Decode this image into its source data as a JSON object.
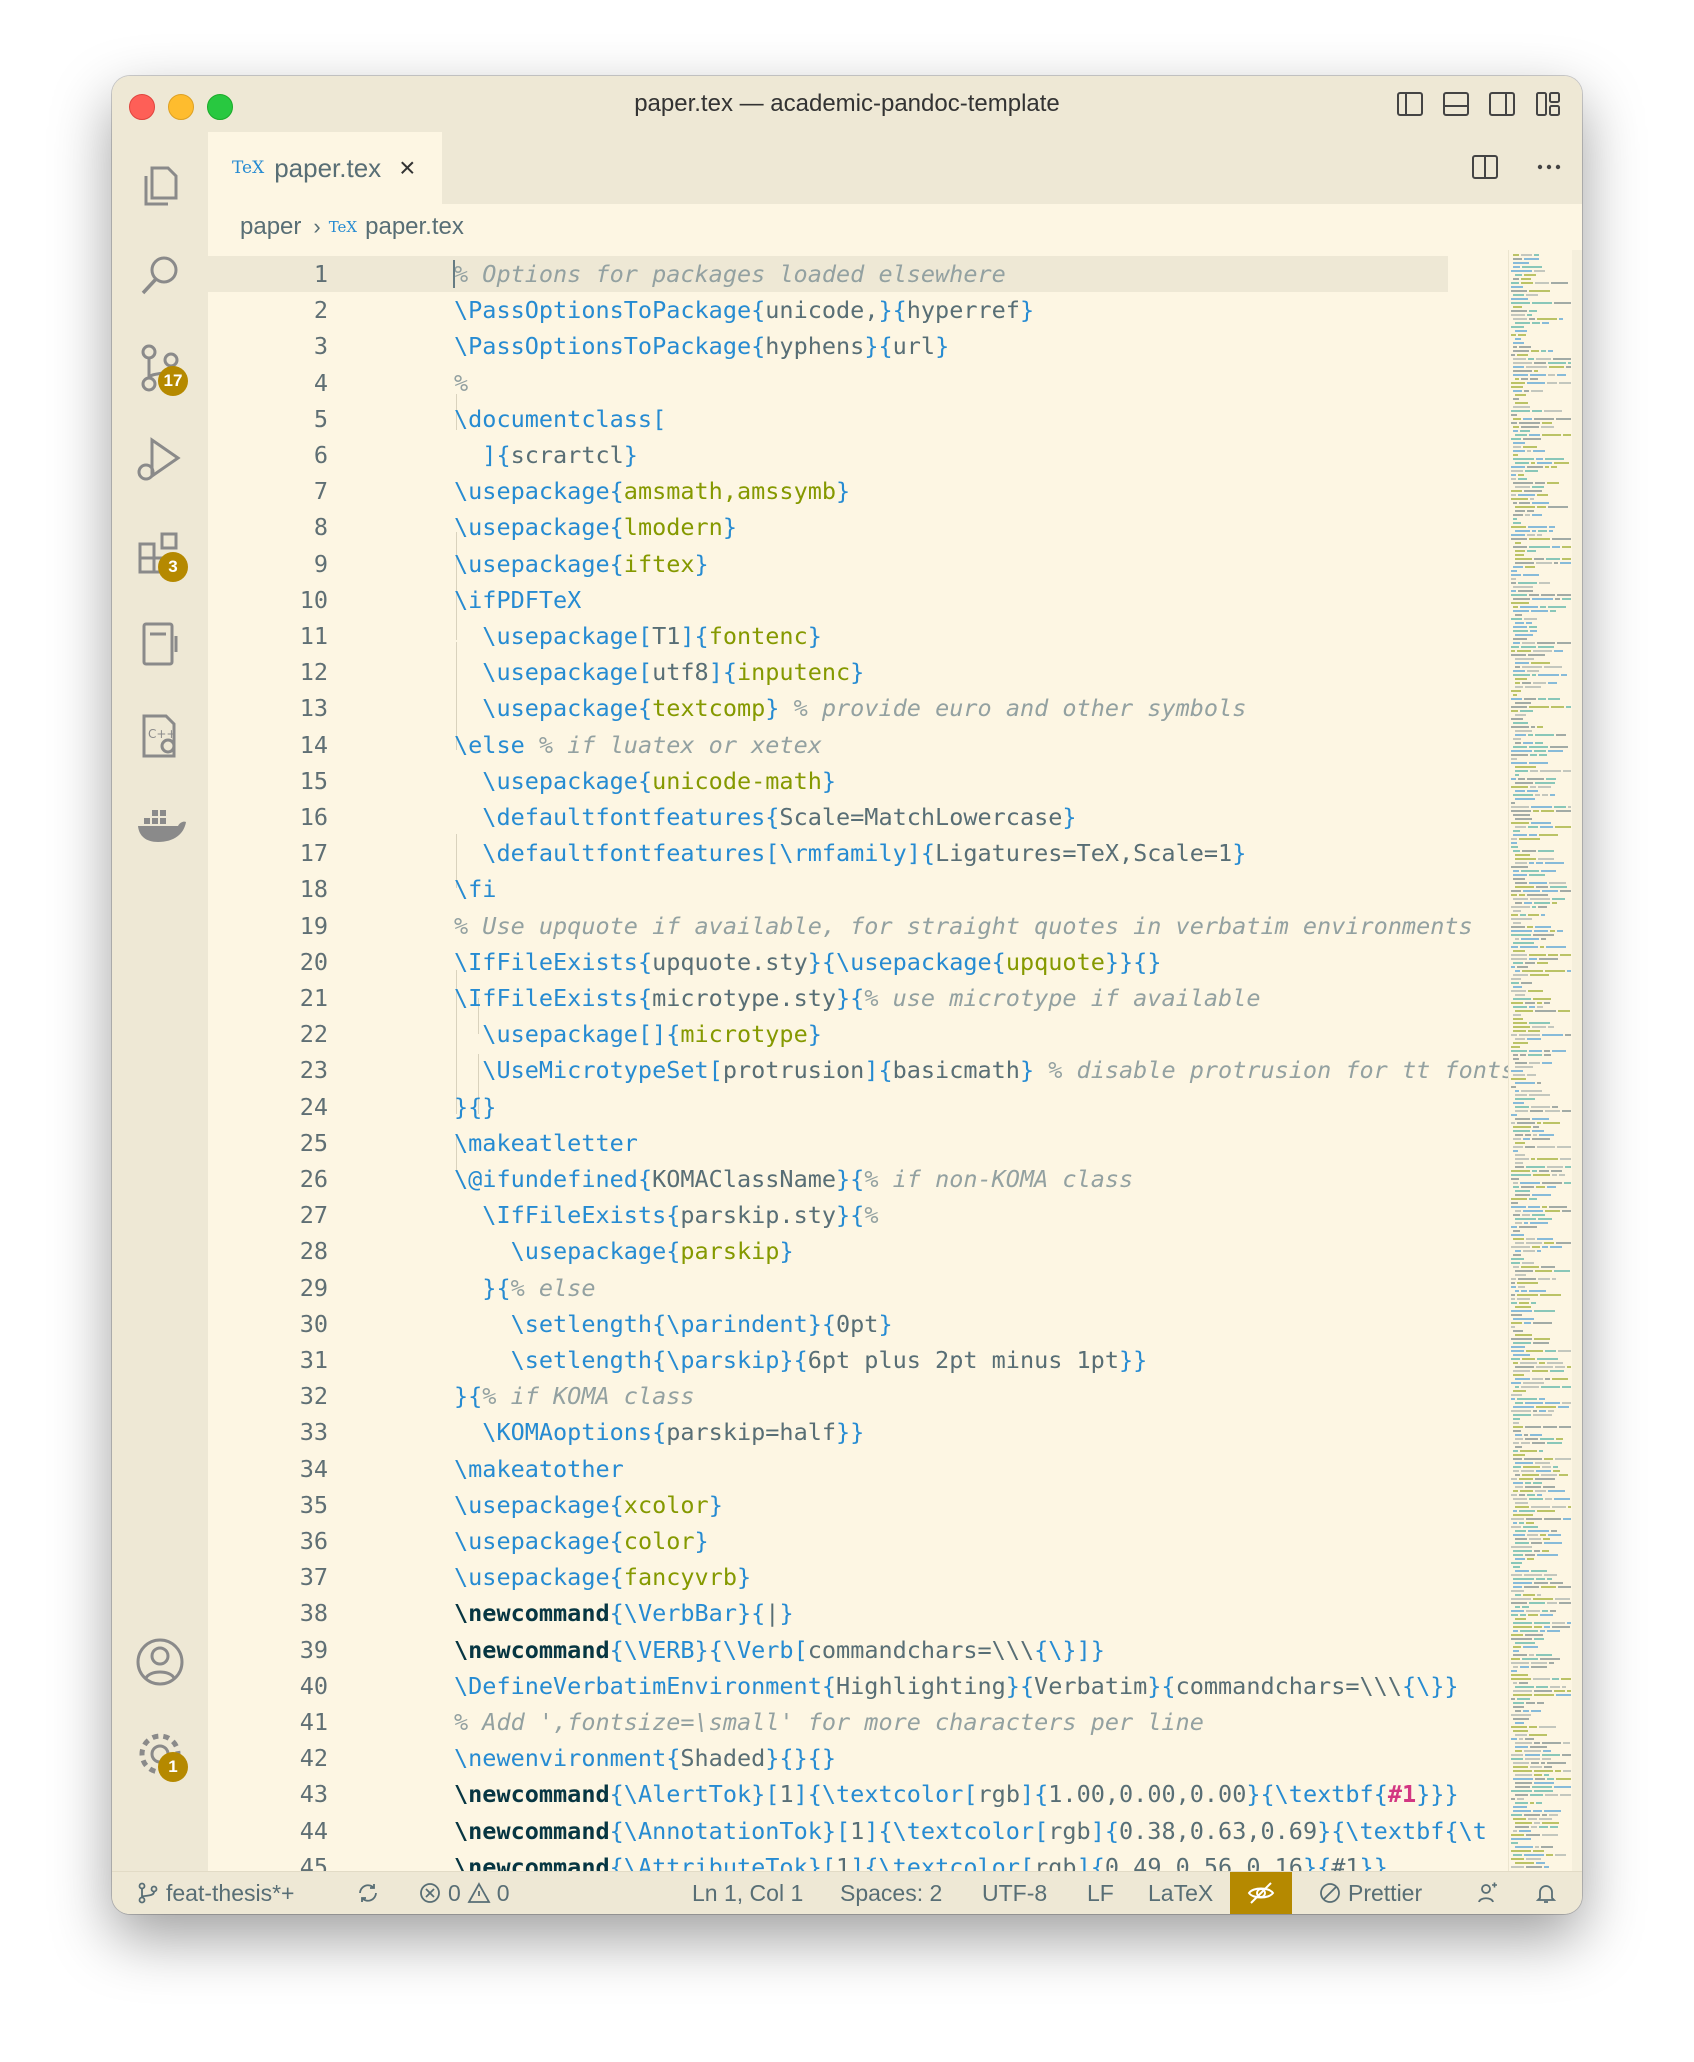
{
  "window": {
    "title": "paper.tex — academic-pandoc-template"
  },
  "activity_bar": {
    "source_control_badge": "17",
    "extensions_badge": "3",
    "settings_badge": "1"
  },
  "tab": {
    "icon_text": "TeX",
    "label": "paper.tex",
    "close_glyph": "×"
  },
  "breadcrumb": {
    "folder": "paper",
    "icon_text": "TeX",
    "file": "paper.tex"
  },
  "editor": {
    "lines": [
      {
        "n": "1",
        "tokens": [
          [
            "c",
            "% Options for packages loaded elsewhere"
          ]
        ]
      },
      {
        "n": "2",
        "tokens": [
          [
            "k",
            "\\PassOptionsToPackage"
          ],
          [
            "br",
            "{"
          ],
          [
            "n",
            "unicode,"
          ],
          [
            "br",
            "}{"
          ],
          [
            "n",
            "hyperref"
          ],
          [
            "br",
            "}"
          ]
        ]
      },
      {
        "n": "3",
        "tokens": [
          [
            "k",
            "\\PassOptionsToPackage"
          ],
          [
            "br",
            "{"
          ],
          [
            "n",
            "hyphens"
          ],
          [
            "br",
            "}{"
          ],
          [
            "n",
            "url"
          ],
          [
            "br",
            "}"
          ]
        ]
      },
      {
        "n": "4",
        "tokens": [
          [
            "c",
            "%"
          ]
        ]
      },
      {
        "n": "5",
        "tokens": [
          [
            "k",
            "\\documentclass"
          ],
          [
            "br",
            "["
          ]
        ]
      },
      {
        "n": "6",
        "tokens": [
          [
            "n",
            "  "
          ],
          [
            "br",
            "]{"
          ],
          [
            "n",
            "scrartcl"
          ],
          [
            "br",
            "}"
          ]
        ]
      },
      {
        "n": "7",
        "tokens": [
          [
            "k",
            "\\usepackage"
          ],
          [
            "br",
            "{"
          ],
          [
            "a",
            "amsmath,amssymb"
          ],
          [
            "br",
            "}"
          ]
        ]
      },
      {
        "n": "8",
        "tokens": [
          [
            "k",
            "\\usepackage"
          ],
          [
            "br",
            "{"
          ],
          [
            "a",
            "lmodern"
          ],
          [
            "br",
            "}"
          ]
        ]
      },
      {
        "n": "9",
        "tokens": [
          [
            "k",
            "\\usepackage"
          ],
          [
            "br",
            "{"
          ],
          [
            "a",
            "iftex"
          ],
          [
            "br",
            "}"
          ]
        ]
      },
      {
        "n": "10",
        "tokens": [
          [
            "k",
            "\\ifPDFTeX"
          ]
        ]
      },
      {
        "n": "11",
        "tokens": [
          [
            "n",
            "  "
          ],
          [
            "k",
            "\\usepackage"
          ],
          [
            "br",
            "["
          ],
          [
            "n",
            "T1"
          ],
          [
            "br",
            "]{"
          ],
          [
            "a",
            "fontenc"
          ],
          [
            "br",
            "}"
          ]
        ]
      },
      {
        "n": "12",
        "tokens": [
          [
            "n",
            "  "
          ],
          [
            "k",
            "\\usepackage"
          ],
          [
            "br",
            "["
          ],
          [
            "n",
            "utf8"
          ],
          [
            "br",
            "]{"
          ],
          [
            "a",
            "inputenc"
          ],
          [
            "br",
            "}"
          ]
        ]
      },
      {
        "n": "13",
        "tokens": [
          [
            "n",
            "  "
          ],
          [
            "k",
            "\\usepackage"
          ],
          [
            "br",
            "{"
          ],
          [
            "a",
            "textcomp"
          ],
          [
            "br",
            "}"
          ],
          [
            "n",
            " "
          ],
          [
            "c",
            "% provide euro and other symbols"
          ]
        ]
      },
      {
        "n": "14",
        "tokens": [
          [
            "k",
            "\\else"
          ],
          [
            "n",
            " "
          ],
          [
            "c",
            "% if luatex or xetex"
          ]
        ]
      },
      {
        "n": "15",
        "tokens": [
          [
            "n",
            "  "
          ],
          [
            "k",
            "\\usepackage"
          ],
          [
            "br",
            "{"
          ],
          [
            "a",
            "unicode-math"
          ],
          [
            "br",
            "}"
          ]
        ]
      },
      {
        "n": "16",
        "tokens": [
          [
            "n",
            "  "
          ],
          [
            "k",
            "\\defaultfontfeatures"
          ],
          [
            "br",
            "{"
          ],
          [
            "n",
            "Scale=MatchLowercase"
          ],
          [
            "br",
            "}"
          ]
        ]
      },
      {
        "n": "17",
        "tokens": [
          [
            "n",
            "  "
          ],
          [
            "k",
            "\\defaultfontfeatures"
          ],
          [
            "br",
            "["
          ],
          [
            "k",
            "\\rmfamily"
          ],
          [
            "br",
            "]{"
          ],
          [
            "n",
            "Ligatures=TeX,Scale=1"
          ],
          [
            "br",
            "}"
          ]
        ]
      },
      {
        "n": "18",
        "tokens": [
          [
            "k",
            "\\fi"
          ]
        ]
      },
      {
        "n": "19",
        "tokens": [
          [
            "c",
            "% Use upquote if available, for straight quotes in verbatim environments"
          ]
        ]
      },
      {
        "n": "20",
        "tokens": [
          [
            "k",
            "\\IfFileExists"
          ],
          [
            "br",
            "{"
          ],
          [
            "n",
            "upquote.sty"
          ],
          [
            "br",
            "}{"
          ],
          [
            "k",
            "\\usepackage"
          ],
          [
            "br",
            "{"
          ],
          [
            "a",
            "upquote"
          ],
          [
            "br",
            "}}{}"
          ]
        ]
      },
      {
        "n": "21",
        "tokens": [
          [
            "k",
            "\\IfFileExists"
          ],
          [
            "br",
            "{"
          ],
          [
            "n",
            "microtype.sty"
          ],
          [
            "br",
            "}{"
          ],
          [
            "c",
            "% use microtype if available"
          ]
        ]
      },
      {
        "n": "22",
        "tokens": [
          [
            "n",
            "  "
          ],
          [
            "k",
            "\\usepackage"
          ],
          [
            "br",
            "[]{"
          ],
          [
            "a",
            "microtype"
          ],
          [
            "br",
            "}"
          ]
        ]
      },
      {
        "n": "23",
        "tokens": [
          [
            "n",
            "  "
          ],
          [
            "k",
            "\\UseMicrotypeSet"
          ],
          [
            "br",
            "["
          ],
          [
            "n",
            "protrusion"
          ],
          [
            "br",
            "]{"
          ],
          [
            "n",
            "basicmath"
          ],
          [
            "br",
            "}"
          ],
          [
            "n",
            " "
          ],
          [
            "c",
            "% disable protrusion for tt fonts"
          ]
        ]
      },
      {
        "n": "24",
        "tokens": [
          [
            "br",
            "}{}"
          ]
        ]
      },
      {
        "n": "25",
        "tokens": [
          [
            "k",
            "\\makeatletter"
          ]
        ]
      },
      {
        "n": "26",
        "tokens": [
          [
            "k",
            "\\@ifundefined"
          ],
          [
            "br",
            "{"
          ],
          [
            "n",
            "KOMAClassName"
          ],
          [
            "br",
            "}{"
          ],
          [
            "c",
            "% if non-KOMA class"
          ]
        ]
      },
      {
        "n": "27",
        "tokens": [
          [
            "n",
            "  "
          ],
          [
            "k",
            "\\IfFileExists"
          ],
          [
            "br",
            "{"
          ],
          [
            "n",
            "parskip.sty"
          ],
          [
            "br",
            "}{"
          ],
          [
            "c",
            "%"
          ]
        ]
      },
      {
        "n": "28",
        "tokens": [
          [
            "n",
            "    "
          ],
          [
            "k",
            "\\usepackage"
          ],
          [
            "br",
            "{"
          ],
          [
            "a",
            "parskip"
          ],
          [
            "br",
            "}"
          ]
        ]
      },
      {
        "n": "29",
        "tokens": [
          [
            "n",
            "  "
          ],
          [
            "br",
            "}{"
          ],
          [
            "c",
            "% else"
          ]
        ]
      },
      {
        "n": "30",
        "tokens": [
          [
            "n",
            "    "
          ],
          [
            "k",
            "\\setlength"
          ],
          [
            "br",
            "{"
          ],
          [
            "k",
            "\\parindent"
          ],
          [
            "br",
            "}{"
          ],
          [
            "n",
            "0pt"
          ],
          [
            "br",
            "}"
          ]
        ]
      },
      {
        "n": "31",
        "tokens": [
          [
            "n",
            "    "
          ],
          [
            "k",
            "\\setlength"
          ],
          [
            "br",
            "{"
          ],
          [
            "k",
            "\\parskip"
          ],
          [
            "br",
            "}{"
          ],
          [
            "n",
            "6pt plus 2pt minus 1pt"
          ],
          [
            "br",
            "}}"
          ]
        ]
      },
      {
        "n": "32",
        "tokens": [
          [
            "br",
            "}{"
          ],
          [
            "c",
            "% if KOMA class"
          ]
        ]
      },
      {
        "n": "33",
        "tokens": [
          [
            "n",
            "  "
          ],
          [
            "k",
            "\\KOMAoptions"
          ],
          [
            "br",
            "{"
          ],
          [
            "n",
            "parskip=half"
          ],
          [
            "br",
            "}}"
          ]
        ]
      },
      {
        "n": "34",
        "tokens": [
          [
            "k",
            "\\makeatother"
          ]
        ]
      },
      {
        "n": "35",
        "tokens": [
          [
            "k",
            "\\usepackage"
          ],
          [
            "br",
            "{"
          ],
          [
            "a",
            "xcolor"
          ],
          [
            "br",
            "}"
          ]
        ]
      },
      {
        "n": "36",
        "tokens": [
          [
            "k",
            "\\usepackage"
          ],
          [
            "br",
            "{"
          ],
          [
            "a",
            "color"
          ],
          [
            "br",
            "}"
          ]
        ]
      },
      {
        "n": "37",
        "tokens": [
          [
            "k",
            "\\usepackage"
          ],
          [
            "br",
            "{"
          ],
          [
            "a",
            "fancyvrb"
          ],
          [
            "br",
            "}"
          ]
        ]
      },
      {
        "n": "38",
        "tokens": [
          [
            "kb",
            "\\newcommand"
          ],
          [
            "br",
            "{"
          ],
          [
            "k",
            "\\VerbBar"
          ],
          [
            "br",
            "}{"
          ],
          [
            "n",
            "|"
          ],
          [
            "br",
            "}"
          ]
        ]
      },
      {
        "n": "39",
        "tokens": [
          [
            "kb",
            "\\newcommand"
          ],
          [
            "br",
            "{"
          ],
          [
            "k",
            "\\VERB"
          ],
          [
            "br",
            "}{"
          ],
          [
            "k",
            "\\Verb"
          ],
          [
            "br",
            "["
          ],
          [
            "n",
            "commandchars=\\\\\\"
          ],
          [
            "br",
            "{"
          ],
          [
            "k",
            "\\}"
          ],
          [
            "br",
            "]}"
          ]
        ]
      },
      {
        "n": "40",
        "tokens": [
          [
            "k",
            "\\DefineVerbatimEnvironment"
          ],
          [
            "br",
            "{"
          ],
          [
            "n",
            "Highlighting"
          ],
          [
            "br",
            "}{"
          ],
          [
            "n",
            "Verbatim"
          ],
          [
            "br",
            "}{"
          ],
          [
            "n",
            "commandchars=\\\\\\"
          ],
          [
            "br",
            "{"
          ],
          [
            "k",
            "\\}"
          ],
          [
            "br",
            "}"
          ]
        ]
      },
      {
        "n": "41",
        "tokens": [
          [
            "c",
            "% Add ',fontsize=\\small' for more characters per line"
          ]
        ]
      },
      {
        "n": "42",
        "tokens": [
          [
            "k",
            "\\newenvironment"
          ],
          [
            "br",
            "{"
          ],
          [
            "n",
            "Shaded"
          ],
          [
            "br",
            "}{}{}"
          ]
        ]
      },
      {
        "n": "43",
        "tokens": [
          [
            "kb",
            "\\newcommand"
          ],
          [
            "br",
            "{"
          ],
          [
            "k",
            "\\AlertTok"
          ],
          [
            "br",
            "}["
          ],
          [
            "n",
            "1"
          ],
          [
            "br",
            "]{"
          ],
          [
            "k",
            "\\textcolor"
          ],
          [
            "br",
            "["
          ],
          [
            "n",
            "rgb"
          ],
          [
            "br",
            "]{"
          ],
          [
            "n",
            "1.00,0.00,0.00"
          ],
          [
            "br",
            "}{"
          ],
          [
            "k",
            "\\textbf"
          ],
          [
            "br",
            "{"
          ],
          [
            "m",
            "#1"
          ],
          [
            "br",
            "}}}"
          ]
        ]
      },
      {
        "n": "44",
        "tokens": [
          [
            "kb",
            "\\newcommand"
          ],
          [
            "br",
            "{"
          ],
          [
            "k",
            "\\AnnotationTok"
          ],
          [
            "br",
            "}["
          ],
          [
            "n",
            "1"
          ],
          [
            "br",
            "]{"
          ],
          [
            "k",
            "\\textcolor"
          ],
          [
            "br",
            "["
          ],
          [
            "n",
            "rgb"
          ],
          [
            "br",
            "]{"
          ],
          [
            "n",
            "0.38,0.63,0.69"
          ],
          [
            "br",
            "}{"
          ],
          [
            "k",
            "\\textbf"
          ],
          [
            "br",
            "{"
          ],
          [
            "k",
            "\\t"
          ]
        ]
      },
      {
        "n": "45",
        "tokens": [
          [
            "kb",
            "\\newcommand"
          ],
          [
            "br",
            "{"
          ],
          [
            "k",
            "\\AttributeTok"
          ],
          [
            "br",
            "}["
          ],
          [
            "n",
            "1"
          ],
          [
            "br",
            "]{"
          ],
          [
            "k",
            "\\textcolor"
          ],
          [
            "br",
            "["
          ],
          [
            "n",
            "rgb"
          ],
          [
            "br",
            "]{"
          ],
          [
            "n",
            "0.49,0.56,0.16"
          ],
          [
            "br",
            "}{"
          ],
          [
            "n",
            "#1"
          ],
          [
            "br",
            "}}"
          ]
        ]
      }
    ]
  },
  "status_bar": {
    "branch": "feat-thesis*+",
    "errors": "0",
    "warnings": "0",
    "position": "Ln 1, Col 1",
    "spaces": "Spaces: 2",
    "encoding": "UTF-8",
    "eol": "LF",
    "language": "LaTeX",
    "formatter": "Prettier"
  },
  "colors": {
    "background": "#fdf6e3",
    "chrome": "#eee8d5",
    "keyword": "#268bd2",
    "argument": "#859900",
    "comment": "#93a1a1",
    "badge": "#b58900"
  }
}
